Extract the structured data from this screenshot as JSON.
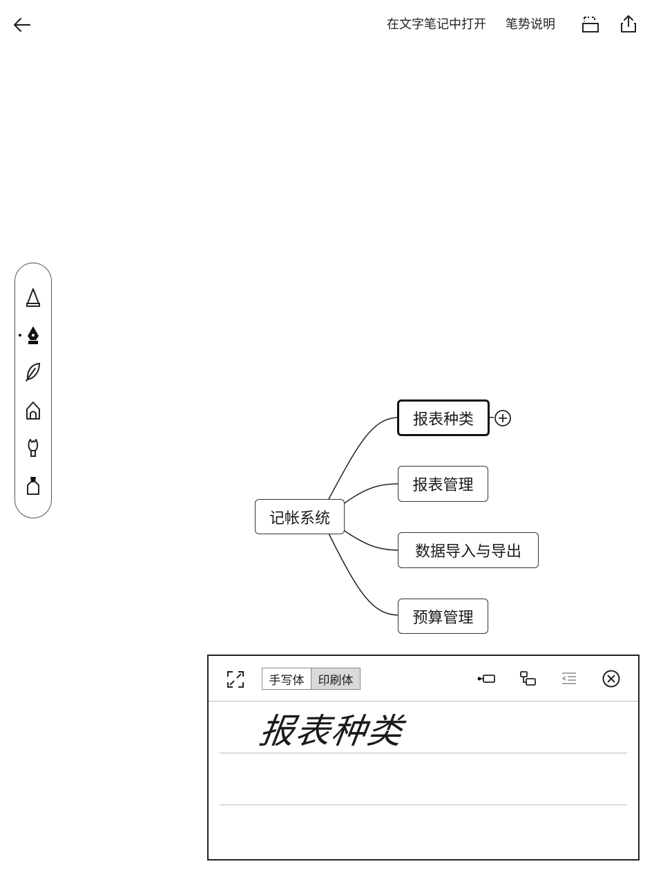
{
  "header": {
    "open_in_text_note": "在文字笔记中打开",
    "gesture_help": "笔势说明"
  },
  "icons": {
    "back": "arrow-left-icon",
    "crop": "crop-icon",
    "share": "share-icon",
    "expand": "expand-icon",
    "add_sibling": "add-sibling-node-icon",
    "add_child": "add-child-node-icon",
    "outdent": "outdent-icon",
    "close": "close-circle-icon",
    "add_node": "plus-circle-icon"
  },
  "pen_tools": [
    {
      "name": "marker-pen-icon",
      "selected": false
    },
    {
      "name": "fountain-pen-icon",
      "selected": true
    },
    {
      "name": "feather-pen-icon",
      "selected": false
    },
    {
      "name": "pencil-icon",
      "selected": false
    },
    {
      "name": "brush-icon",
      "selected": false
    },
    {
      "name": "highlighter-icon",
      "selected": false
    }
  ],
  "mindmap": {
    "root": "记帐系统",
    "children": [
      {
        "label": "报表种类",
        "selected": true
      },
      {
        "label": "报表管理",
        "selected": false
      },
      {
        "label": "数据导入与导出",
        "selected": false
      },
      {
        "label": "预算管理",
        "selected": false
      }
    ]
  },
  "handwriting_panel": {
    "mode_handwriting": "手写体",
    "mode_print": "印刷体",
    "active_mode": "印刷体",
    "written_text": "报表种类"
  }
}
